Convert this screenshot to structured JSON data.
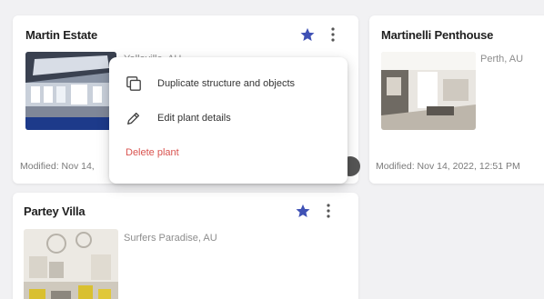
{
  "cards": [
    {
      "title": "Martin Estate",
      "location": "Yallaville, AU",
      "modified": "Modified: Nov 14,"
    },
    {
      "title": "Martinelli Penthouse",
      "location": "Perth, AU",
      "modified": "Modified: Nov 14, 2022, 12:51 PM"
    },
    {
      "title": "Partey Villa",
      "location": "Surfers Paradise, AU",
      "modified": ""
    }
  ],
  "menu": {
    "items": [
      {
        "label": "Duplicate structure and objects",
        "icon": "duplicate-icon"
      },
      {
        "label": "Edit plant details",
        "icon": "pencil-icon"
      },
      {
        "label": "Delete plant",
        "icon": ""
      }
    ]
  },
  "colors": {
    "star": "#3f51b5",
    "danger": "#d9534f"
  }
}
